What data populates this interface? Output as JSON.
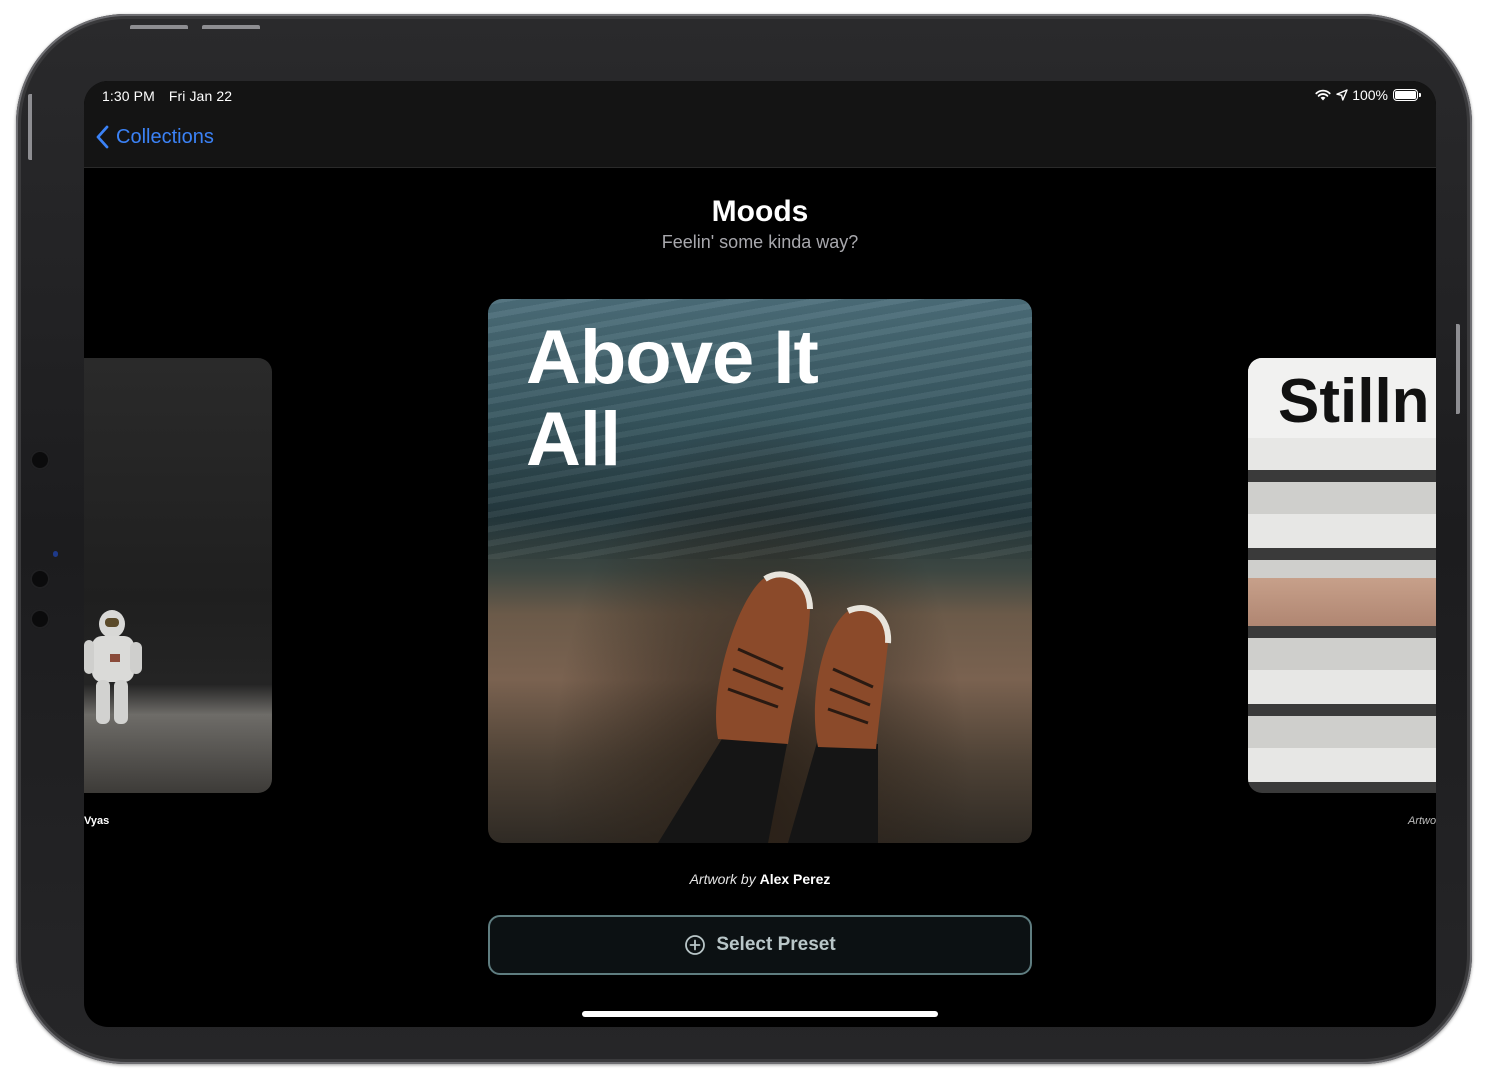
{
  "status_bar": {
    "time": "1:30 PM",
    "date": "Fri Jan 22",
    "battery": "100%",
    "battery_level": 1.0
  },
  "nav": {
    "back_label": "Collections"
  },
  "collection": {
    "title": "Moods",
    "subtitle": "Feelin' some kinda way?"
  },
  "cards": {
    "left": {
      "credit_fragment": "Vyas"
    },
    "center": {
      "title_line1": "Above It",
      "title_line2": "All",
      "credit_prefix": "Artwork by",
      "credit_name": "Alex Perez"
    },
    "right": {
      "title_fragment": "Stilln",
      "credit_fragment": "Artwo"
    }
  },
  "actions": {
    "select_preset_label": "Select Preset"
  },
  "colors": {
    "accent": "#3b82f6",
    "button_border": "#5f7d80",
    "background": "#000000"
  },
  "icons": [
    "chevron-left-icon",
    "wifi-icon",
    "location-arrow-icon",
    "battery-icon",
    "plus-circle-icon"
  ]
}
